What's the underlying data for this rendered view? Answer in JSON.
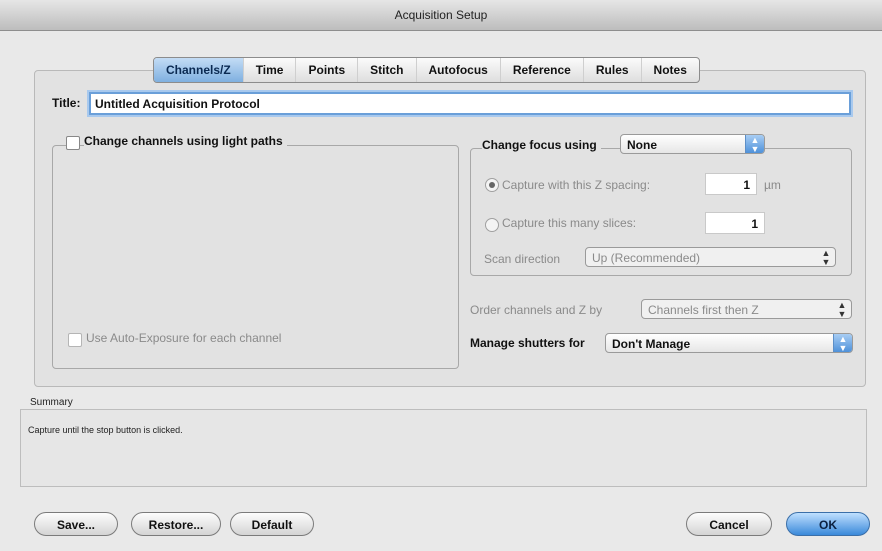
{
  "window": {
    "title": "Acquisition Setup"
  },
  "tabs": [
    {
      "label": "Channels/Z",
      "active": true
    },
    {
      "label": "Time"
    },
    {
      "label": "Points"
    },
    {
      "label": "Stitch"
    },
    {
      "label": "Autofocus"
    },
    {
      "label": "Reference"
    },
    {
      "label": "Rules"
    },
    {
      "label": "Notes"
    }
  ],
  "title_field": {
    "label": "Title:",
    "value": "Untitled Acquisition Protocol"
  },
  "channels": {
    "checkbox_label": "Change channels using light paths",
    "auto_exposure_label": "Use Auto-Exposure for each channel"
  },
  "focus": {
    "label": "Change focus using",
    "selected": "None",
    "capture_spacing_label": "Capture with this Z spacing:",
    "spacing_value": "1",
    "spacing_unit": "µm",
    "capture_slices_label": "Capture this many slices:",
    "slices_value": "1",
    "scan_direction_label": "Scan direction",
    "scan_direction_value": "Up (Recommended)"
  },
  "order": {
    "label": "Order channels and Z by",
    "value": "Channels first then Z"
  },
  "shutters": {
    "label": "Manage shutters for",
    "value": "Don't Manage"
  },
  "summary": {
    "label": "Summary",
    "text": "Capture until the stop button is clicked."
  },
  "buttons": {
    "save": "Save...",
    "restore": "Restore...",
    "default": "Default",
    "cancel": "Cancel",
    "ok": "OK"
  },
  "colors": {
    "accent": "#3a89da",
    "tab_active": "#7fb0e0"
  },
  "icons": {
    "popup_arrows": "updown-arrows-icon"
  }
}
